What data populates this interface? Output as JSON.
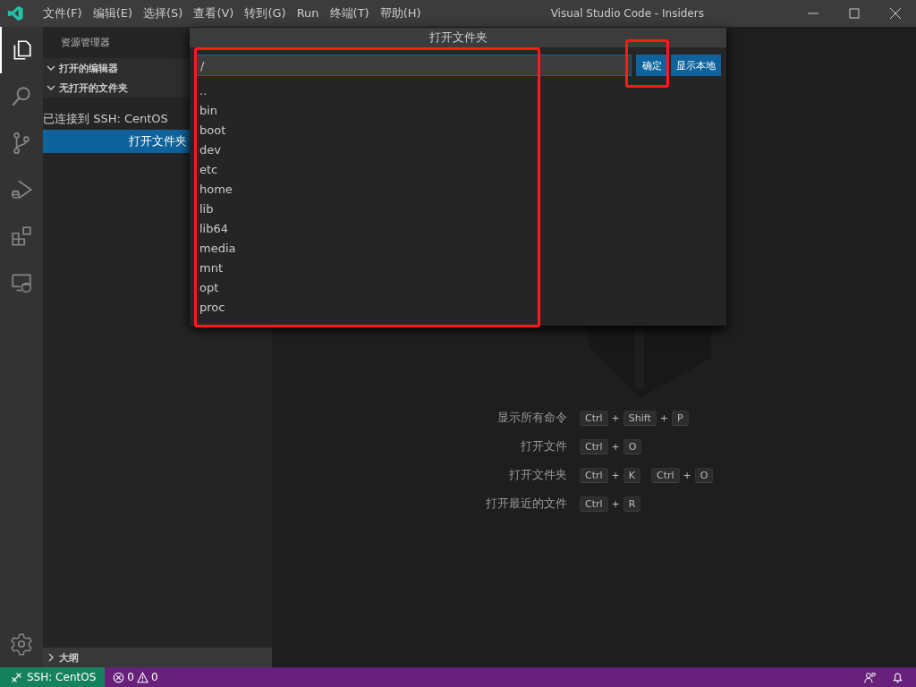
{
  "window": {
    "title": "Visual Studio Code - Insiders"
  },
  "menu": [
    {
      "label": "文件(F)"
    },
    {
      "label": "编辑(E)"
    },
    {
      "label": "选择(S)"
    },
    {
      "label": "查看(V)"
    },
    {
      "label": "转到(G)"
    },
    {
      "label": "Run"
    },
    {
      "label": "终端(T)"
    },
    {
      "label": "帮助(H)"
    }
  ],
  "activity_bar": {
    "items": [
      {
        "kind": "files",
        "selected": true
      },
      {
        "kind": "search",
        "selected": false
      },
      {
        "kind": "source-control",
        "selected": false
      },
      {
        "kind": "run",
        "selected": false
      },
      {
        "kind": "extensions",
        "selected": false
      },
      {
        "kind": "remote",
        "selected": false
      }
    ]
  },
  "sidebar": {
    "title": "资源管理器",
    "sections": [
      {
        "label": "打开的编辑器",
        "expanded": true
      },
      {
        "label": "无打开的文件夹",
        "expanded": true
      }
    ],
    "message": "已连接到 SSH: CentOS",
    "button": "打开文件夹",
    "outline": {
      "label": "大纲",
      "expanded": false
    }
  },
  "dialog": {
    "title": "打开文件夹",
    "input": {
      "value": "/"
    },
    "buttons": [
      {
        "label": "确定",
        "highlighted": true
      },
      {
        "label": "显示本地",
        "highlighted": false
      }
    ],
    "list_highlighted": true,
    "items": [
      {
        "label": ".."
      },
      {
        "label": "bin"
      },
      {
        "label": "boot"
      },
      {
        "label": "dev"
      },
      {
        "label": "etc"
      },
      {
        "label": "home"
      },
      {
        "label": "lib"
      },
      {
        "label": "lib64"
      },
      {
        "label": "media"
      },
      {
        "label": "mnt"
      },
      {
        "label": "opt"
      },
      {
        "label": "proc"
      }
    ]
  },
  "welcome": {
    "shortcuts": [
      {
        "label": "显示所有命令",
        "chords": [
          [
            {
              "kind": "key",
              "text": "Ctrl"
            },
            {
              "kind": "plus",
              "text": "+"
            },
            {
              "kind": "key",
              "text": "Shift"
            },
            {
              "kind": "plus",
              "text": "+"
            },
            {
              "kind": "key",
              "text": "P"
            }
          ]
        ]
      },
      {
        "label": "打开文件",
        "chords": [
          [
            {
              "kind": "key",
              "text": "Ctrl"
            },
            {
              "kind": "plus",
              "text": "+"
            },
            {
              "kind": "key",
              "text": "O"
            }
          ]
        ]
      },
      {
        "label": "打开文件夹",
        "chords": [
          [
            {
              "kind": "key",
              "text": "Ctrl"
            },
            {
              "kind": "plus",
              "text": "+"
            },
            {
              "kind": "key",
              "text": "K"
            }
          ],
          [
            {
              "kind": "key",
              "text": "Ctrl"
            },
            {
              "kind": "plus",
              "text": "+"
            },
            {
              "kind": "key",
              "text": "O"
            }
          ]
        ]
      },
      {
        "label": "打开最近的文件",
        "chords": [
          [
            {
              "kind": "key",
              "text": "Ctrl"
            },
            {
              "kind": "plus",
              "text": "+"
            },
            {
              "kind": "key",
              "text": "R"
            }
          ]
        ]
      }
    ]
  },
  "status_bar": {
    "remote": "SSH: CentOS",
    "errors": "0",
    "warnings": "0"
  }
}
